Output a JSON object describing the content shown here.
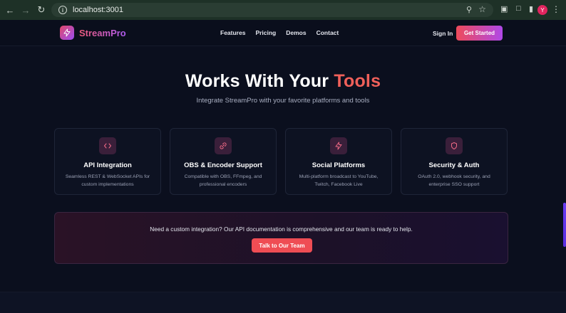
{
  "browser": {
    "url": "localhost:3001",
    "profile_initial": "Y"
  },
  "header": {
    "logo_text": "StreamPro",
    "nav": [
      "Features",
      "Pricing",
      "Demos",
      "Contact"
    ],
    "sign_in": "Sign In",
    "get_started": "Get Started"
  },
  "hero": {
    "title_main": "Works With Your",
    "title_accent": "Tools",
    "subtitle": "Integrate StreamPro with your favorite platforms and tools"
  },
  "cards": [
    {
      "icon": "code-icon",
      "title": "API Integration",
      "desc": "Seamless REST & WebSocket APIs for custom implementations"
    },
    {
      "icon": "link-icon",
      "title": "OBS & Encoder Support",
      "desc": "Compatible with OBS, FFmpeg, and professional encoders"
    },
    {
      "icon": "lightning-icon",
      "title": "Social Platforms",
      "desc": "Multi-platform broadcast to YouTube, Twitch, Facebook Live"
    },
    {
      "icon": "shield-icon",
      "title": "Security & Auth",
      "desc": "OAuth 2.0, webhook security, and enterprise SSO support"
    }
  ],
  "cta": {
    "text": "Need a custom integration? Our API documentation is comprehensive and our team is ready to help.",
    "button": "Talk to Our Team"
  },
  "colors": {
    "accent": "#f0605a",
    "brand_gradient_start": "#ee4a5a",
    "brand_gradient_end": "#b048e8",
    "background": "#0b0f1e"
  }
}
